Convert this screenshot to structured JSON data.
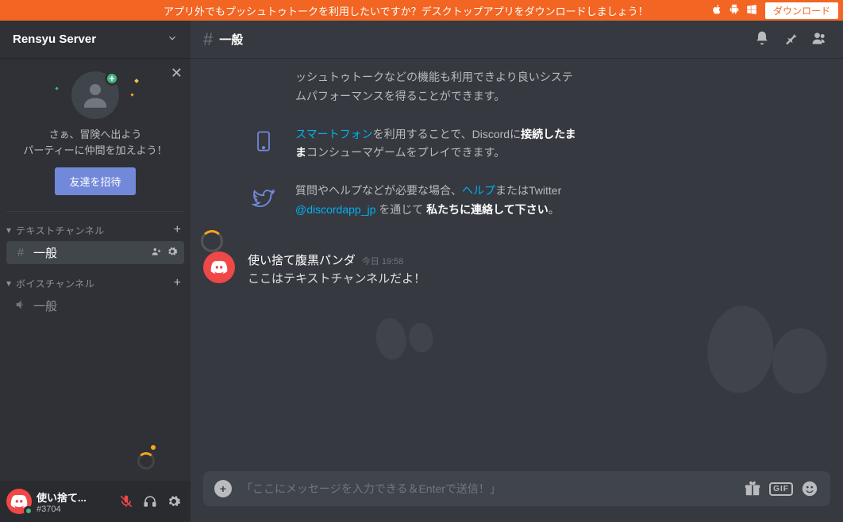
{
  "banner": {
    "message": "アプリ外でもプッシュトゥトークを利用したいですか？デスクトップアプリをダウンロードしましょう！",
    "download_label": "ダウンロード"
  },
  "server": {
    "name": "Rensyu Server"
  },
  "invite": {
    "line1": "さぁ、冒険へ出よう",
    "line2": "パーティーに仲間を加えよう！",
    "button": "友達を招待"
  },
  "sections": {
    "text_header": "テキストチャンネル",
    "voice_header": "ボイスチャンネル"
  },
  "channels": {
    "text": [
      {
        "name": "一般",
        "active": true
      }
    ],
    "voice": [
      {
        "name": "一般"
      }
    ]
  },
  "user_panel": {
    "name": "使い捨て...",
    "tag": "#3704"
  },
  "chat_header": {
    "channel": "一般"
  },
  "welcome": {
    "desktop_tail": "ッシュトゥトークなどの機能も利用できより良いシステムパフォーマンスを得ることができます。",
    "phone_link": "スマートフォン",
    "phone_mid1": "を利用することで、Discordに",
    "phone_bold": "接続したまま",
    "phone_mid2": "コンシューマゲームをプレイできます。",
    "twitter_pre": "質問やヘルプなどが必要な場合、",
    "twitter_help": "ヘルプ",
    "twitter_mid": "またはTwitter ",
    "twitter_handle": "@discordapp_jp",
    "twitter_post": " を通じて ",
    "twitter_bold": "私たちに連絡して下さい",
    "twitter_end": "。"
  },
  "message": {
    "author": "使い捨て腹黒パンダ",
    "time_prefix": "今日",
    "time": "19:58",
    "body": "ここはテキストチャンネルだよ！"
  },
  "input": {
    "placeholder": "「ここにメッセージを入力できる＆Enterで送信！」",
    "gif_label": "GIF"
  }
}
